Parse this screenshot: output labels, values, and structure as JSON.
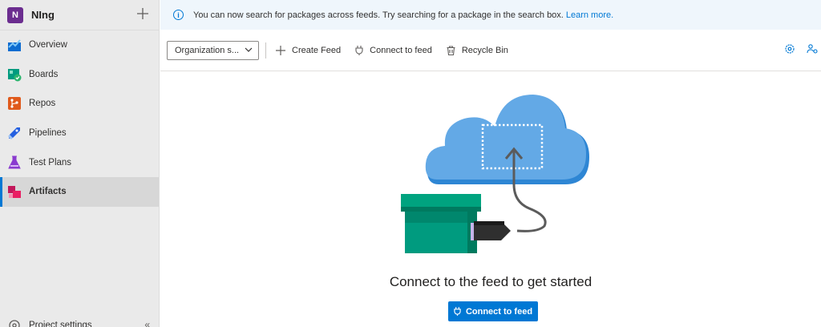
{
  "project": {
    "badge": "N",
    "name": "NIng"
  },
  "sidebar": {
    "items": [
      {
        "label": "Overview"
      },
      {
        "label": "Boards"
      },
      {
        "label": "Repos"
      },
      {
        "label": "Pipelines"
      },
      {
        "label": "Test Plans"
      },
      {
        "label": "Artifacts"
      }
    ],
    "active": "Artifacts",
    "bottom_label": "Project settings"
  },
  "banner": {
    "text": "You can now search for packages across feeds. Try searching for a package in the search box.",
    "link": "Learn more."
  },
  "toolbar": {
    "feed_select": "Organization s...",
    "create_feed": "Create Feed",
    "connect_feed": "Connect to feed",
    "recycle_bin": "Recycle Bin"
  },
  "empty_state": {
    "title": "Connect to the feed to get started",
    "button": "Connect to feed"
  },
  "colors": {
    "accent": "#0078d4",
    "box": "#009b7f",
    "cloud": "#63a9e6"
  }
}
